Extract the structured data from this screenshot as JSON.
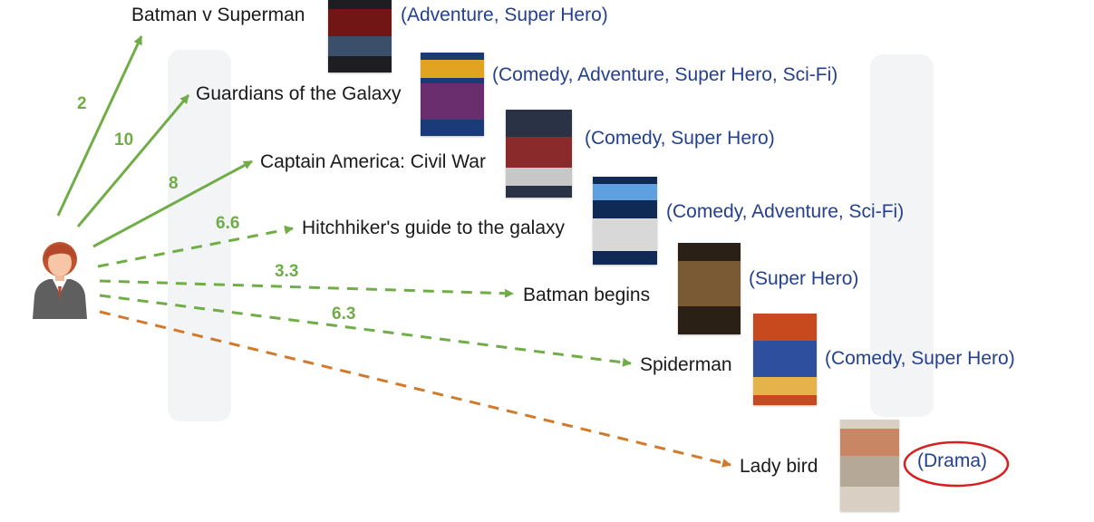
{
  "colors": {
    "rated_arrow": "#70ad47",
    "recommended_arrow": "#d27a2c",
    "score_text": "#70ad47",
    "genre_text": "#24408e",
    "title_text": "#1a1a1a",
    "highlight_ring": "#d81e1e"
  },
  "user": {
    "icon": "user-avatar-icon"
  },
  "movies": [
    {
      "title": "Batman v Superman",
      "genres": "(Adventure, Super Hero)",
      "score": "2",
      "style": "solid"
    },
    {
      "title": "Guardians of the Galaxy",
      "genres": "(Comedy, Adventure, Super Hero, Sci-Fi)",
      "score": "10",
      "style": "solid"
    },
    {
      "title": "Captain America: Civil War",
      "genres": "(Comedy, Super Hero)",
      "score": "8",
      "style": "solid"
    },
    {
      "title": "Hitchhiker's guide to the galaxy",
      "genres": "(Comedy, Adventure, Sci-Fi)",
      "score": "6.6",
      "style": "dashed"
    },
    {
      "title": "Batman begins",
      "genres": "(Super Hero)",
      "score": "3.3",
      "style": "dashed"
    },
    {
      "title": "Spiderman",
      "genres": "(Comedy, Super Hero)",
      "score": "6.3",
      "style": "dashed"
    },
    {
      "title": "Lady bird",
      "genres": "(Drama)",
      "score": "",
      "style": "dashed-orange",
      "highlighted": true
    }
  ]
}
